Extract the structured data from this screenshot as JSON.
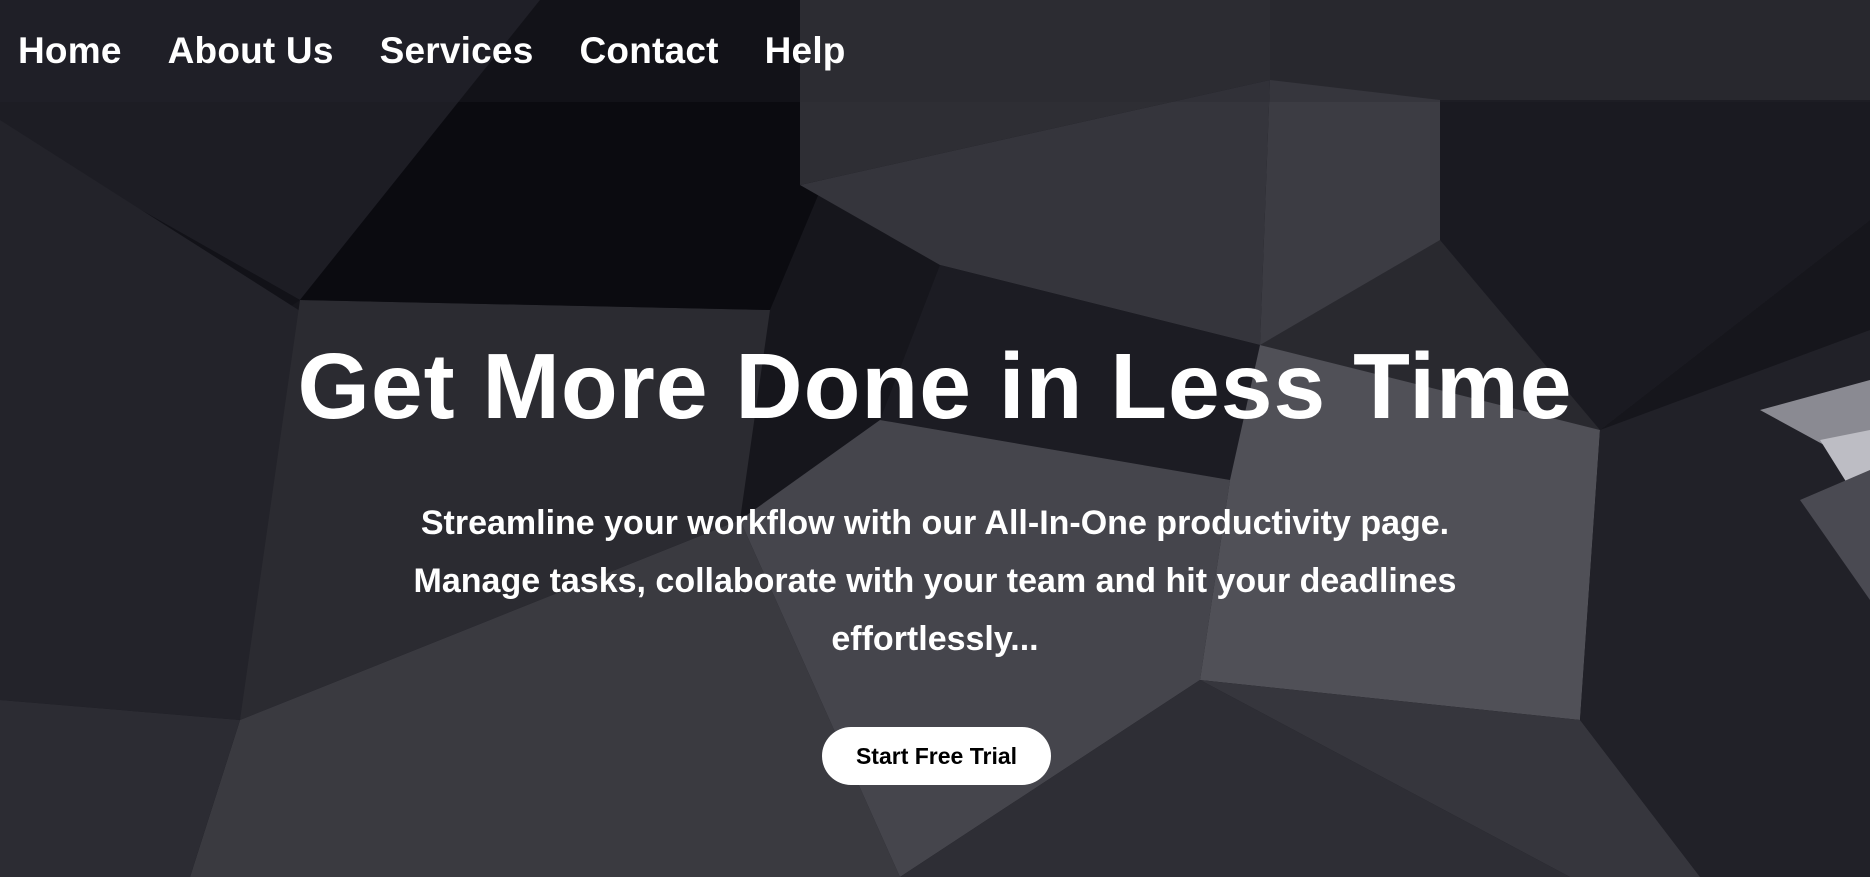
{
  "nav": {
    "items": [
      {
        "label": "Home"
      },
      {
        "label": "About Us"
      },
      {
        "label": "Services"
      },
      {
        "label": "Contact"
      },
      {
        "label": "Help"
      }
    ]
  },
  "hero": {
    "headline": "Get More Done in Less Time",
    "subtext": "Streamline your workflow with our All-In-One productivity page. Manage tasks, collaborate with your team and hit your deadlines effortlessly...",
    "cta_label": "Start Free Trial"
  },
  "colors": {
    "text": "#ffffff",
    "background": "#17171e",
    "button_bg": "#ffffff",
    "button_text": "#000000"
  }
}
